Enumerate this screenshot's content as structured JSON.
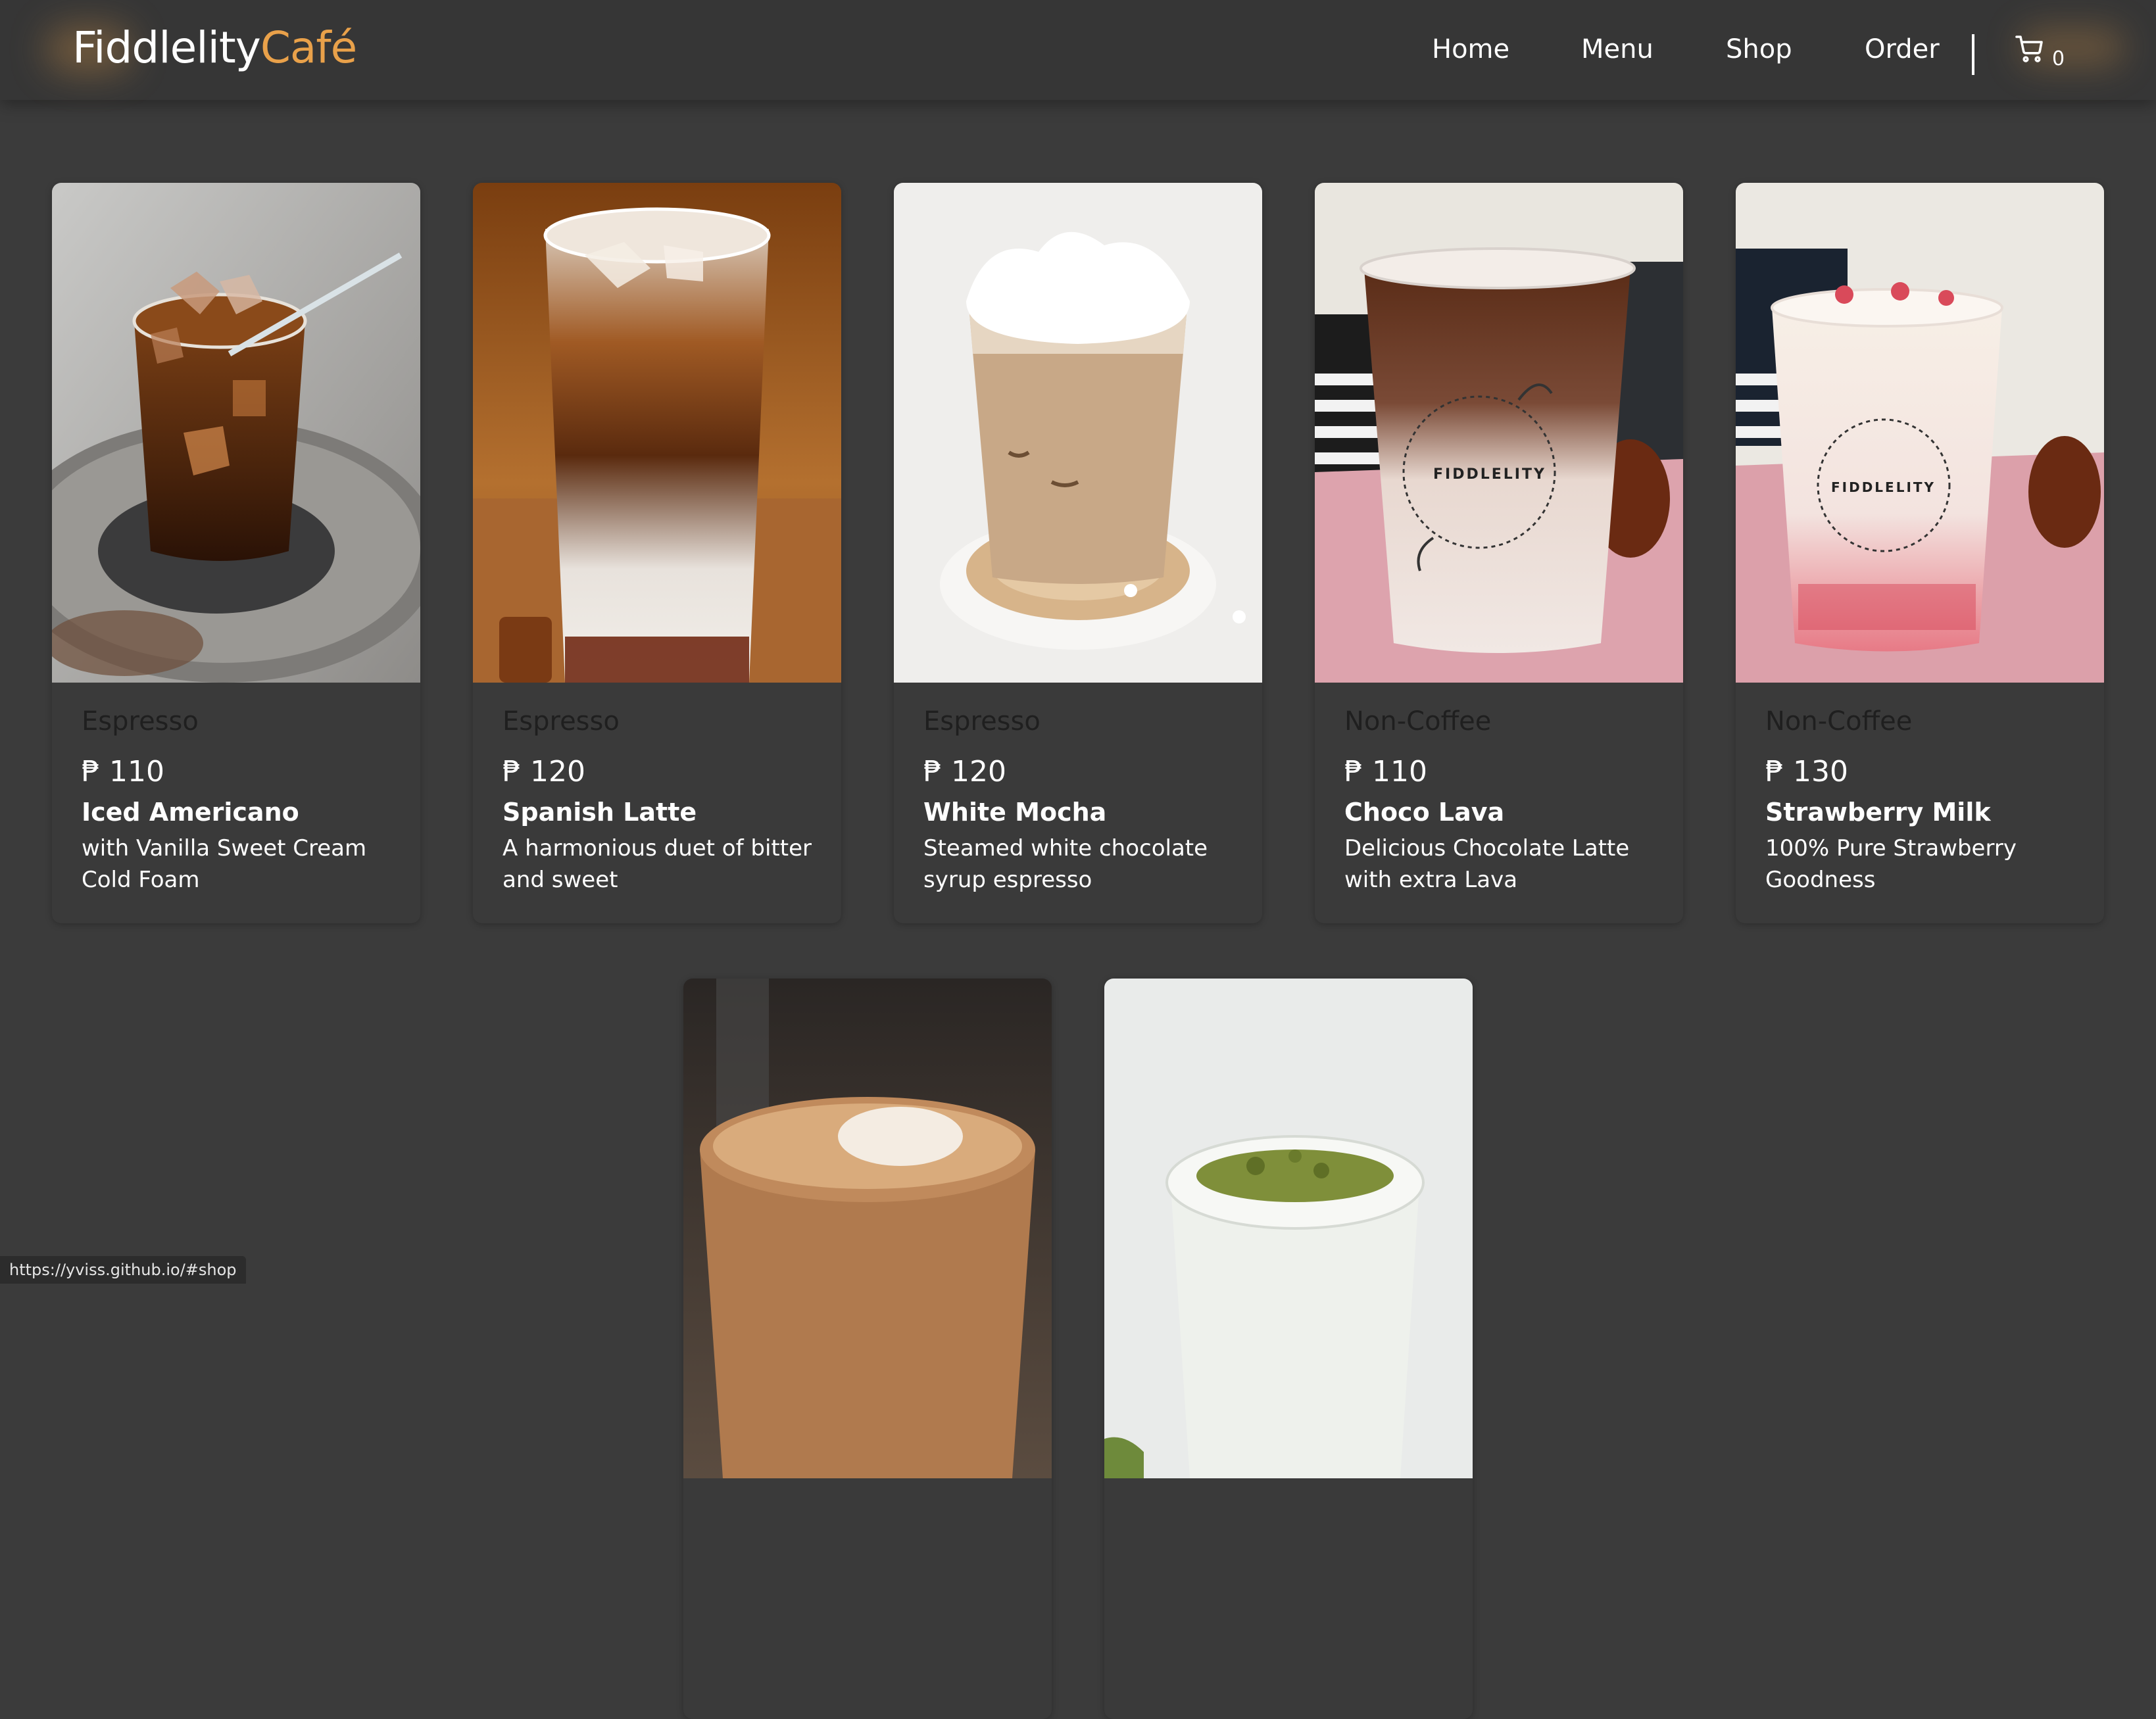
{
  "brand": {
    "name_part1": "Fiddlelity",
    "name_part2": "Café",
    "accent_color": "#e9a14a"
  },
  "nav": {
    "links": [
      {
        "label": "Home"
      },
      {
        "label": "Menu"
      },
      {
        "label": "Shop"
      },
      {
        "label": "Order"
      }
    ],
    "cart_icon": "cart-icon",
    "cart_count": "0"
  },
  "products": [
    {
      "category": "Espresso",
      "price": "₱ 110",
      "name": "Iced Americano",
      "description": "with Vanilla Sweet Cream Cold Foam"
    },
    {
      "category": "Espresso",
      "price": "₱ 120",
      "name": "Spanish Latte",
      "description": "A harmonious duet of bitter and sweet"
    },
    {
      "category": "Espresso",
      "price": "₱ 120",
      "name": "White Mocha",
      "description": "Steamed white chocolate syrup espresso"
    },
    {
      "category": "Non-Coffee",
      "price": "₱ 110",
      "name": "Choco Lava",
      "description": "Delicious Chocolate Latte with extra Lava"
    },
    {
      "category": "Non-Coffee",
      "price": "₱ 130",
      "name": "Strawberry Milk",
      "description": "100% Pure Strawberry Goodness"
    },
    {
      "category": "",
      "price": "",
      "name": "",
      "description": ""
    },
    {
      "category": "",
      "price": "",
      "name": "",
      "description": ""
    }
  ],
  "cup_logo_text": "FIDDLELITY",
  "status_url": "https://yviss.github.io/#shop"
}
